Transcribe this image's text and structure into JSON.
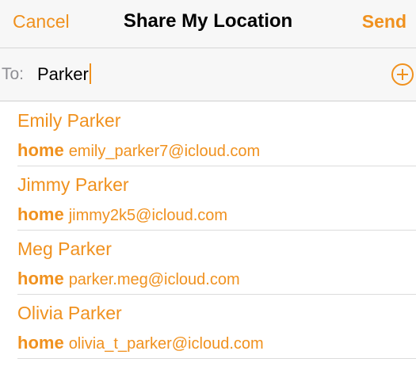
{
  "navbar": {
    "cancel_label": "Cancel",
    "title": "Share My Location",
    "send_label": "Send"
  },
  "recipient": {
    "to_label": "To:",
    "value": "Parker",
    "add_icon": "add-contact-icon"
  },
  "contacts": [
    {
      "name": "Emily Parker",
      "type": "home",
      "email": "emily_parker7@icloud.com"
    },
    {
      "name": "Jimmy Parker",
      "type": "home",
      "email": "jimmy2k5@icloud.com"
    },
    {
      "name": "Meg Parker",
      "type": "home",
      "email": "parker.meg@icloud.com"
    },
    {
      "name": "Olivia Parker",
      "type": "home",
      "email": "olivia_t_parker@icloud.com"
    }
  ],
  "colors": {
    "accent": "#f0911e",
    "nav_background": "#f7f7f7",
    "secondary_text": "#8e8e93"
  }
}
